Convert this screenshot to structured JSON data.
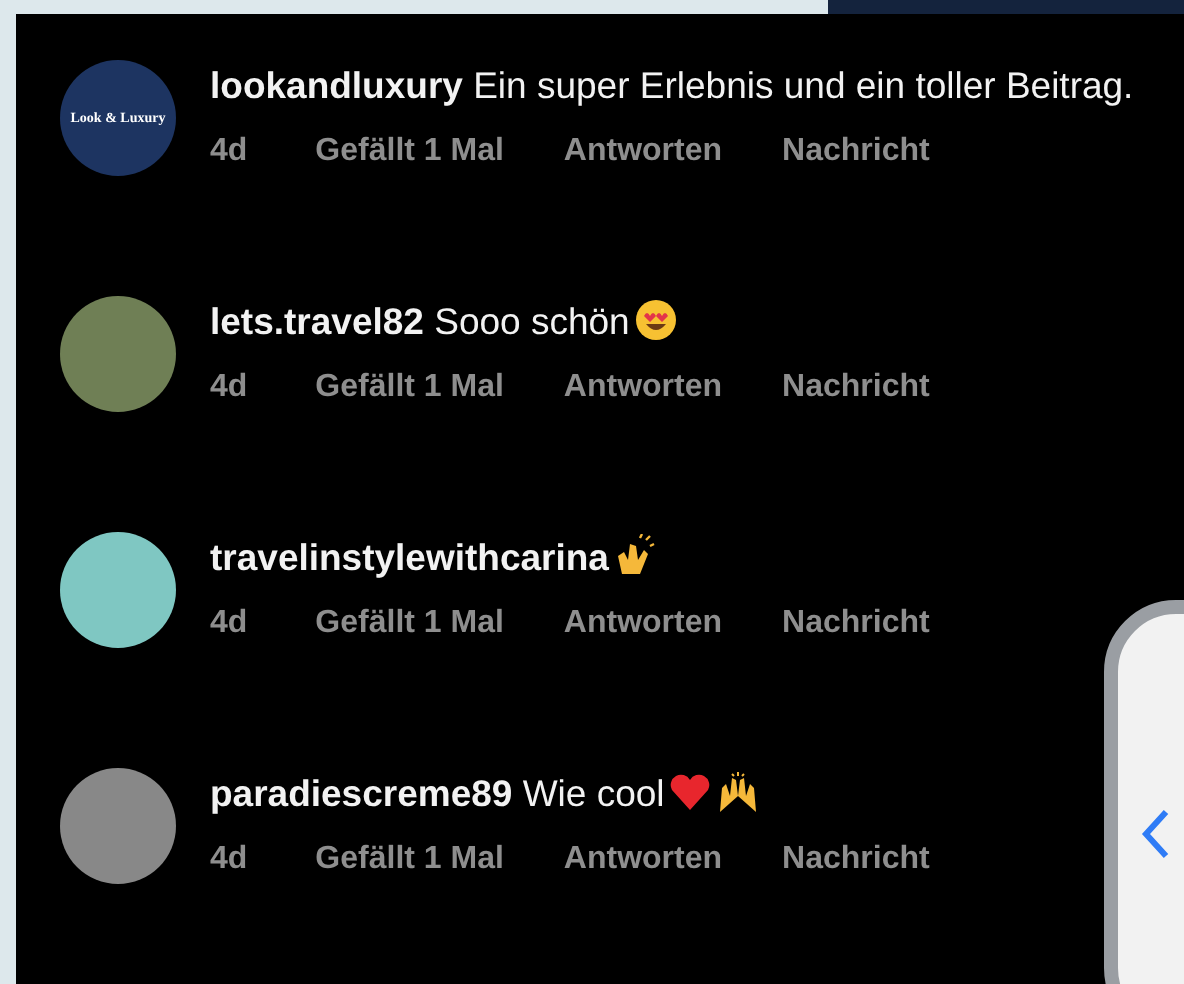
{
  "comments": [
    {
      "avatar": {
        "kind": "logo",
        "logo_text": "Look & Luxury"
      },
      "username": "lookandluxury",
      "text": "Ein super Erlebnis und ein toller Beitrag.",
      "time": "4d",
      "likes": "Gefällt 1 Mal",
      "reply": "Antworten",
      "message": "Nachricht"
    },
    {
      "avatar": {
        "kind": "photo"
      },
      "username": "lets.travel82",
      "text": "Sooo schön",
      "emojis": [
        {
          "kind": "heart-eyes"
        }
      ],
      "time": "4d",
      "likes": "Gefällt 1 Mal",
      "reply": "Antworten",
      "message": "Nachricht"
    },
    {
      "avatar": {
        "kind": "photo"
      },
      "username": "travelinstylewithcarina",
      "emojis": [
        {
          "kind": "clap"
        }
      ],
      "time": "4d",
      "likes": "Gefällt 1 Mal",
      "reply": "Antworten",
      "message": "Nachricht"
    },
    {
      "avatar": {
        "kind": "photo"
      },
      "username": "paradiescreme89",
      "text": "Wie cool",
      "emojis": [
        {
          "kind": "heart"
        },
        {
          "kind": "raised-hands"
        }
      ],
      "time": "4d",
      "likes": "Gefällt 1 Mal",
      "reply": "Antworten",
      "message": "Nachricht"
    }
  ]
}
